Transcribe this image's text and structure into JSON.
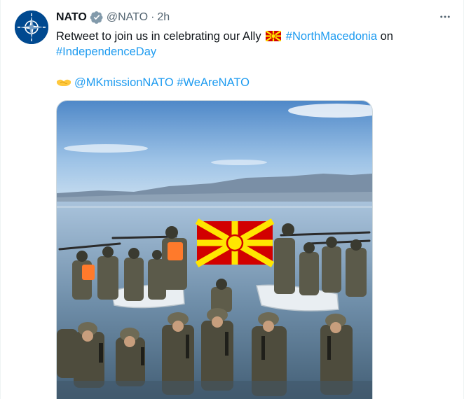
{
  "tweet": {
    "display_name": "NATO",
    "handle": "@NATO",
    "separator": "·",
    "time": "2h",
    "more_icon": "more-horizontal-icon",
    "verified_icon": "verified-badge-icon",
    "line1_text": "Retweet to join us in celebrating our Ally",
    "flag_emoji": "north-macedonia-flag-emoji",
    "hashtag_north_macedonia": "#NorthMacedonia",
    "line1_suffix": "on",
    "hashtag_independence_day": "#IndependenceDay",
    "handshake_emoji": "handshake-emoji",
    "mention": "@MKmissionNATO",
    "hashtag_we_are_nato": "#WeAreNATO",
    "media_description_icon": "photo"
  },
  "colors": {
    "link": "#1d9bf0",
    "text": "#0f1419",
    "secondary": "#536471",
    "nato_blue": "#004990",
    "verified_gray": "#829aab",
    "flag_red": "#d20000",
    "flag_yellow": "#ffe600"
  }
}
